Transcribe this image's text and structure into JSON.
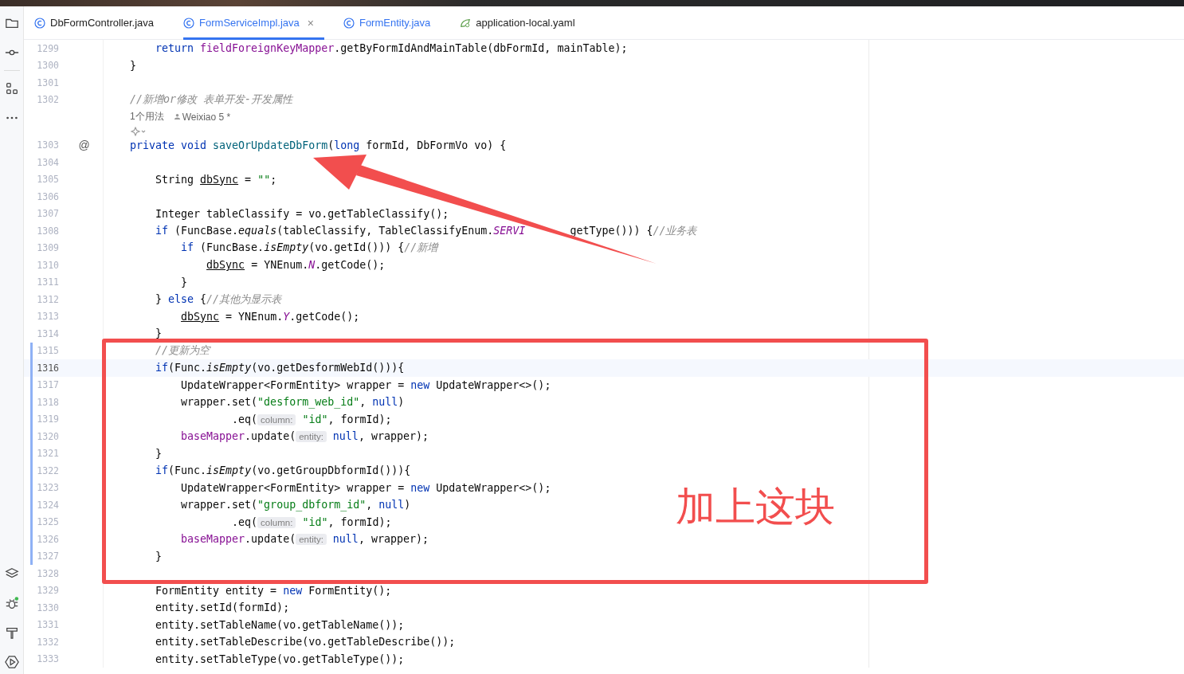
{
  "tabs": [
    {
      "label": "DbFormController.java",
      "kind": "class",
      "modified": false,
      "selected": false
    },
    {
      "label": "FormServiceImpl.java",
      "kind": "class",
      "modified": true,
      "selected": true,
      "close": "×"
    },
    {
      "label": "FormEntity.java",
      "kind": "class",
      "modified": true,
      "selected": false
    },
    {
      "label": "application-local.yaml",
      "kind": "yaml",
      "modified": false,
      "selected": false
    }
  ],
  "editor": {
    "lines": [
      {
        "number": "1299",
        "kind": "code",
        "changed": false,
        "current": false,
        "tokens": [
          {
            "t": "    return ",
            "kind": "kw"
          },
          {
            "t": "fieldForeignKeyMapper",
            "kind": "member"
          },
          {
            "t": ".getByFormIdAndMainTable(dbFormId, mainTable);",
            "kind": "plain"
          }
        ]
      },
      {
        "number": "1300",
        "kind": "code",
        "changed": false,
        "current": false,
        "tokens": [
          {
            "t": "}",
            "kind": "plain"
          }
        ]
      },
      {
        "number": "1301",
        "kind": "code",
        "changed": false,
        "current": false
      },
      {
        "number": "1302",
        "kind": "code",
        "changed": false,
        "current": false,
        "tokens": [
          {
            "t": "//新增or修改 表单开发-开发属性",
            "kind": "comment"
          }
        ]
      },
      {
        "kind": "usages",
        "usages": "1个用法",
        "author": "Weixiao 5 *"
      },
      {
        "kind": "inlay-icon"
      },
      {
        "number": "1303",
        "kind": "code",
        "changed": false,
        "current": false,
        "gutter_mark": "@",
        "tokens": [
          {
            "t": "private void ",
            "kind": "kw"
          },
          {
            "t": "saveOrUpdateDbForm",
            "kind": "fn"
          },
          {
            "t": "(",
            "kind": "plain"
          },
          {
            "t": "long",
            "kind": "kw"
          },
          {
            "t": " formId, DbFormVo vo) {",
            "kind": "plain"
          }
        ]
      },
      {
        "number": "1304",
        "kind": "code",
        "changed": false,
        "current": false
      },
      {
        "number": "1305",
        "kind": "code",
        "changed": false,
        "current": false,
        "tokens": [
          {
            "t": "    String ",
            "kind": "plain"
          },
          {
            "t": "dbSync",
            "kind": "var"
          },
          {
            "t": " = ",
            "kind": "plain"
          },
          {
            "t": "\"\"",
            "kind": "str"
          },
          {
            "t": ";",
            "kind": "plain"
          }
        ]
      },
      {
        "number": "1306",
        "kind": "code",
        "changed": false,
        "current": false
      },
      {
        "number": "1307",
        "kind": "code",
        "changed": false,
        "current": false,
        "tokens": [
          {
            "t": "    Integer tableClassify = vo.getTableClassify();",
            "kind": "plain"
          }
        ]
      },
      {
        "number": "1308",
        "kind": "code",
        "changed": false,
        "current": false,
        "tokens": [
          {
            "t": "    if",
            "kind": "kw"
          },
          {
            "t": " (FuncBase.",
            "kind": "plain"
          },
          {
            "t": "equals",
            "kind": "static"
          },
          {
            "t": "(tableClassify, TableClassifyEnum.",
            "kind": "plain"
          },
          {
            "t": "SERVI",
            "kind": "field"
          },
          {
            "t": "getType())) {",
            "kind": "plain",
            "covered_before": true
          },
          {
            "t": "//业务表",
            "kind": "comment"
          }
        ]
      },
      {
        "number": "1309",
        "kind": "code",
        "changed": false,
        "current": false,
        "tokens": [
          {
            "t": "        if",
            "kind": "kw"
          },
          {
            "t": " (FuncBase.",
            "kind": "plain"
          },
          {
            "t": "isEmpty",
            "kind": "static"
          },
          {
            "t": "(vo.getId())) {",
            "kind": "plain"
          },
          {
            "t": "//新增",
            "kind": "comment"
          }
        ]
      },
      {
        "number": "1310",
        "kind": "code",
        "changed": false,
        "current": false,
        "tokens": [
          {
            "t": "            dbSync",
            "kind": "var"
          },
          {
            "t": " = YNEnum.",
            "kind": "plain"
          },
          {
            "t": "N",
            "kind": "field"
          },
          {
            "t": ".getCode();",
            "kind": "plain"
          }
        ]
      },
      {
        "number": "1311",
        "kind": "code",
        "changed": false,
        "current": false,
        "tokens": [
          {
            "t": "        }",
            "kind": "plain"
          }
        ]
      },
      {
        "number": "1312",
        "kind": "code",
        "changed": false,
        "current": false,
        "tokens": [
          {
            "t": "    } ",
            "kind": "plain"
          },
          {
            "t": "else",
            "kind": "kw"
          },
          {
            "t": " {",
            "kind": "plain"
          },
          {
            "t": "//其他为显示表",
            "kind": "comment"
          }
        ]
      },
      {
        "number": "1313",
        "kind": "code",
        "changed": false,
        "current": false,
        "tokens": [
          {
            "t": "        dbSync",
            "kind": "var"
          },
          {
            "t": " = YNEnum.",
            "kind": "plain"
          },
          {
            "t": "Y",
            "kind": "field"
          },
          {
            "t": ".getCode();",
            "kind": "plain"
          }
        ]
      },
      {
        "number": "1314",
        "kind": "code",
        "changed": false,
        "current": false,
        "tokens": [
          {
            "t": "    }",
            "kind": "plain"
          }
        ]
      },
      {
        "number": "1315",
        "kind": "code",
        "changed": true,
        "current": false,
        "tokens": [
          {
            "t": "    //更新为空",
            "kind": "comment"
          }
        ]
      },
      {
        "number": "1316",
        "kind": "code",
        "changed": true,
        "current": true,
        "tokens": [
          {
            "t": "    if",
            "kind": "kw"
          },
          {
            "t": "(Func.",
            "kind": "plain"
          },
          {
            "t": "isEmpty",
            "kind": "static"
          },
          {
            "t": "(vo.getDesformWebId())){",
            "kind": "plain"
          }
        ]
      },
      {
        "number": "1317",
        "kind": "code",
        "changed": true,
        "current": false,
        "tokens": [
          {
            "t": "        UpdateWrapper<FormEntity> wrapper = ",
            "kind": "plain"
          },
          {
            "t": "new",
            "kind": "kw"
          },
          {
            "t": " UpdateWrapper<>();",
            "kind": "plain"
          }
        ]
      },
      {
        "number": "1318",
        "kind": "code",
        "changed": true,
        "current": false,
        "tokens": [
          {
            "t": "        wrapper.set(",
            "kind": "plain"
          },
          {
            "t": "\"desform_web_id\"",
            "kind": "str"
          },
          {
            "t": ", ",
            "kind": "plain"
          },
          {
            "t": "null",
            "kind": "kw"
          },
          {
            "t": ")",
            "kind": "plain"
          }
        ]
      },
      {
        "number": "1319",
        "kind": "code",
        "changed": true,
        "current": false,
        "tokens": [
          {
            "t": "                .eq(",
            "kind": "plain"
          },
          {
            "t": "column:",
            "kind": "hint"
          },
          {
            "t": " \"id\"",
            "kind": "str"
          },
          {
            "t": ", formId);",
            "kind": "plain"
          }
        ]
      },
      {
        "number": "1320",
        "kind": "code",
        "changed": true,
        "current": false,
        "tokens": [
          {
            "t": "        baseMapper",
            "kind": "member"
          },
          {
            "t": ".update(",
            "kind": "plain"
          },
          {
            "t": "entity:",
            "kind": "hint"
          },
          {
            "t": " null",
            "kind": "kw"
          },
          {
            "t": ", wrapper);",
            "kind": "plain"
          }
        ]
      },
      {
        "number": "1321",
        "kind": "code",
        "changed": true,
        "current": false,
        "tokens": [
          {
            "t": "    }",
            "kind": "plain"
          }
        ]
      },
      {
        "number": "1322",
        "kind": "code",
        "changed": true,
        "current": false,
        "tokens": [
          {
            "t": "    if",
            "kind": "kw"
          },
          {
            "t": "(Func.",
            "kind": "plain"
          },
          {
            "t": "isEmpty",
            "kind": "static"
          },
          {
            "t": "(vo.getGroupDbformId())){",
            "kind": "plain"
          }
        ]
      },
      {
        "number": "1323",
        "kind": "code",
        "changed": true,
        "current": false,
        "tokens": [
          {
            "t": "        UpdateWrapper<FormEntity> wrapper = ",
            "kind": "plain"
          },
          {
            "t": "new",
            "kind": "kw"
          },
          {
            "t": " UpdateWrapper<>();",
            "kind": "plain"
          }
        ]
      },
      {
        "number": "1324",
        "kind": "code",
        "changed": true,
        "current": false,
        "tokens": [
          {
            "t": "        wrapper.set(",
            "kind": "plain"
          },
          {
            "t": "\"group_dbform_id\"",
            "kind": "str"
          },
          {
            "t": ", ",
            "kind": "plain"
          },
          {
            "t": "null",
            "kind": "kw"
          },
          {
            "t": ")",
            "kind": "plain"
          }
        ]
      },
      {
        "number": "1325",
        "kind": "code",
        "changed": true,
        "current": false,
        "tokens": [
          {
            "t": "                .eq(",
            "kind": "plain"
          },
          {
            "t": "column:",
            "kind": "hint"
          },
          {
            "t": " \"id\"",
            "kind": "str"
          },
          {
            "t": ", formId);",
            "kind": "plain"
          }
        ]
      },
      {
        "number": "1326",
        "kind": "code",
        "changed": true,
        "current": false,
        "tokens": [
          {
            "t": "        baseMapper",
            "kind": "member"
          },
          {
            "t": ".update(",
            "kind": "plain"
          },
          {
            "t": "entity:",
            "kind": "hint"
          },
          {
            "t": " null",
            "kind": "kw"
          },
          {
            "t": ", wrapper);",
            "kind": "plain"
          }
        ]
      },
      {
        "number": "1327",
        "kind": "code",
        "changed": true,
        "current": false,
        "tokens": [
          {
            "t": "    }",
            "kind": "plain"
          }
        ]
      },
      {
        "number": "1328",
        "kind": "code",
        "changed": false,
        "current": false
      },
      {
        "number": "1329",
        "kind": "code",
        "changed": false,
        "current": false,
        "tokens": [
          {
            "t": "    FormEntity entity = ",
            "kind": "plain"
          },
          {
            "t": "new",
            "kind": "kw"
          },
          {
            "t": " FormEntity();",
            "kind": "plain"
          }
        ]
      },
      {
        "number": "1330",
        "kind": "code",
        "changed": false,
        "current": false,
        "tokens": [
          {
            "t": "    entity.setId(formId);",
            "kind": "plain"
          }
        ]
      },
      {
        "number": "1331",
        "kind": "code",
        "changed": false,
        "current": false,
        "tokens": [
          {
            "t": "    entity.setTableName(vo.getTableName());",
            "kind": "plain"
          }
        ]
      },
      {
        "number": "1332",
        "kind": "code",
        "changed": false,
        "current": false,
        "tokens": [
          {
            "t": "    entity.setTableDescribe(vo.getTableDescribe());",
            "kind": "plain"
          }
        ]
      },
      {
        "number": "1333",
        "kind": "code",
        "changed": false,
        "current": false,
        "tokens": [
          {
            "t": "    entity.setTableType(vo.getTableType());",
            "kind": "plain"
          }
        ]
      }
    ]
  },
  "annotation": {
    "note": "加上这块"
  }
}
